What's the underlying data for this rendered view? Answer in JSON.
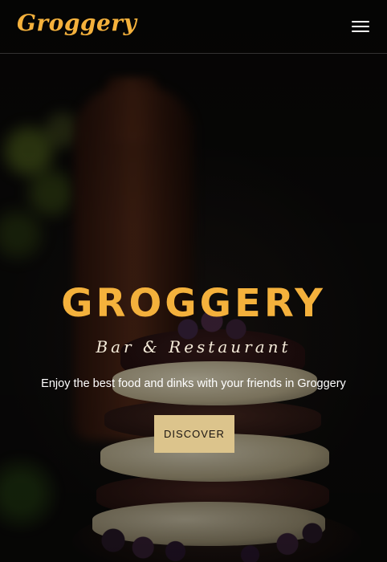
{
  "header": {
    "logo_text": "Groggery",
    "menu_icon": "hamburger-menu-icon"
  },
  "hero": {
    "title": "GROGGERY",
    "subtitle": "Bar & Restaurant",
    "description": "Enjoy the best food and dinks with your friends in Groggery",
    "cta_label": "DISCOVER"
  },
  "colors": {
    "accent": "#f4b13c",
    "button_bg": "#dcc48c",
    "text_light": "#ffffff",
    "background": "#0b0a09"
  }
}
